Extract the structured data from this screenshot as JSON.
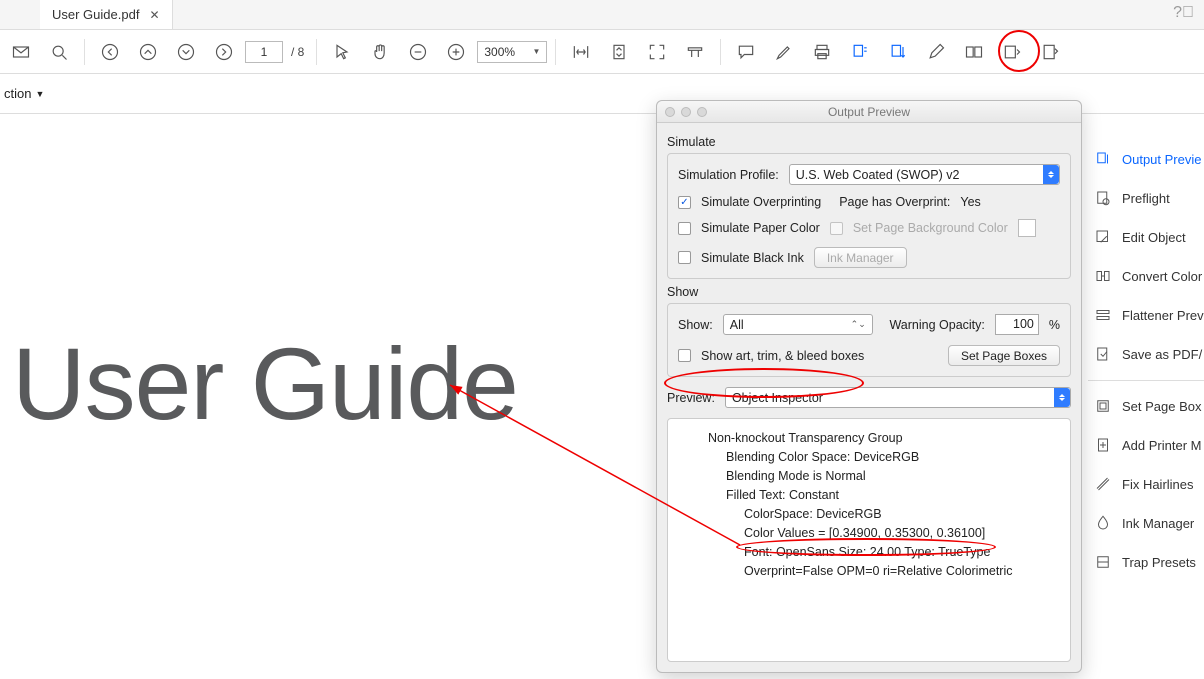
{
  "tab": {
    "title": "User Guide.pdf"
  },
  "page": {
    "current": "1",
    "total": "8"
  },
  "zoom": "300%",
  "secbar": {
    "label": "ction"
  },
  "document_heading": "User Guide",
  "rail": {
    "items": [
      {
        "label": "Output Previe",
        "active": true
      },
      {
        "label": "Preflight"
      },
      {
        "label": "Edit Object"
      },
      {
        "label": "Convert Color"
      },
      {
        "label": "Flattener Prev"
      },
      {
        "label": "Save as PDF/"
      }
    ],
    "items2": [
      {
        "label": "Set Page Box"
      },
      {
        "label": "Add Printer M"
      },
      {
        "label": "Fix Hairlines"
      },
      {
        "label": "Ink Manager"
      },
      {
        "label": "Trap Presets"
      }
    ]
  },
  "panel": {
    "title": "Output Preview",
    "simulate": {
      "section": "Simulate",
      "profile_label": "Simulation Profile:",
      "profile_value": "U.S. Web Coated (SWOP) v2",
      "overprint_label": "Simulate Overprinting",
      "overprint_info_label": "Page has Overprint:",
      "overprint_info_value": "Yes",
      "papercolor_label": "Simulate Paper Color",
      "setbg_label": "Set Page Background Color",
      "blackink_label": "Simulate Black Ink",
      "inkmgr_btn": "Ink Manager"
    },
    "show": {
      "section": "Show",
      "show_label": "Show:",
      "show_value": "All",
      "warn_label": "Warning Opacity:",
      "warn_value": "100",
      "warn_unit": "%",
      "boxes_label": "Show art, trim, & bleed boxes",
      "setboxes_btn": "Set Page Boxes"
    },
    "preview": {
      "label": "Preview:",
      "value": "Object Inspector"
    },
    "inspector": {
      "l1": "Non-knockout Transparency Group",
      "l2a": "Blending Color Space: DeviceRGB",
      "l2b": "Blending Mode is Normal",
      "l2c": "Filled Text: Constant",
      "l3a": "ColorSpace: DeviceRGB",
      "l3b": "Color Values = [0.34900, 0.35300, 0.36100]",
      "l3c": "Font: OpenSans Size: 24.00 Type: TrueType",
      "l3d": "Overprint=False OPM=0 ri=Relative Colorimetric"
    }
  }
}
